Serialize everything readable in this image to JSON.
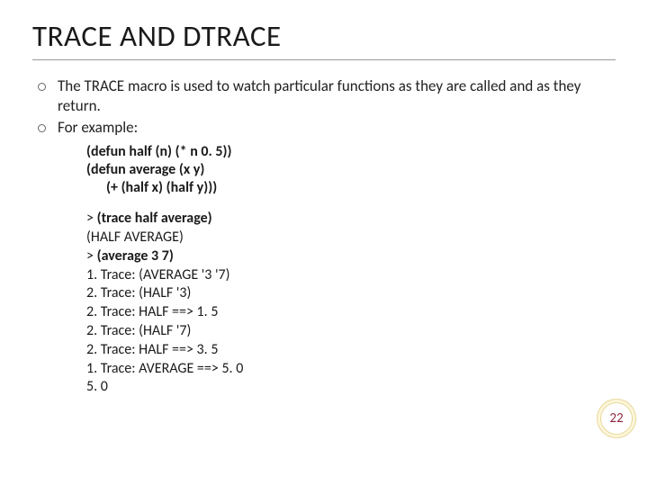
{
  "title": "TRACE AND DTRACE",
  "bullets": [
    "The TRACE macro is used to watch particular functions as they are called and as they return.",
    "For example:"
  ],
  "code": {
    "line1": "(defun half (n) (* n 0. 5))",
    "line2": "(defun average (x y)",
    "line3": "(+ (half x) (half y)))"
  },
  "trace": {
    "l1_prefix": "> ",
    "l1_bold": "(trace half average)",
    "l2": "(HALF AVERAGE)",
    "l3_prefix": "> ",
    "l3_bold": "(average 3 7)",
    "l4": "1. Trace: (AVERAGE '3 '7)",
    "l5": "2. Trace: (HALF '3)",
    "l6": "2. Trace: HALF ==> 1. 5",
    "l7": "2. Trace: (HALF '7)",
    "l8": "2. Trace: HALF ==> 3. 5",
    "l9": "1. Trace: AVERAGE ==> 5. 0",
    "l10": "5. 0"
  },
  "page_number": "22"
}
